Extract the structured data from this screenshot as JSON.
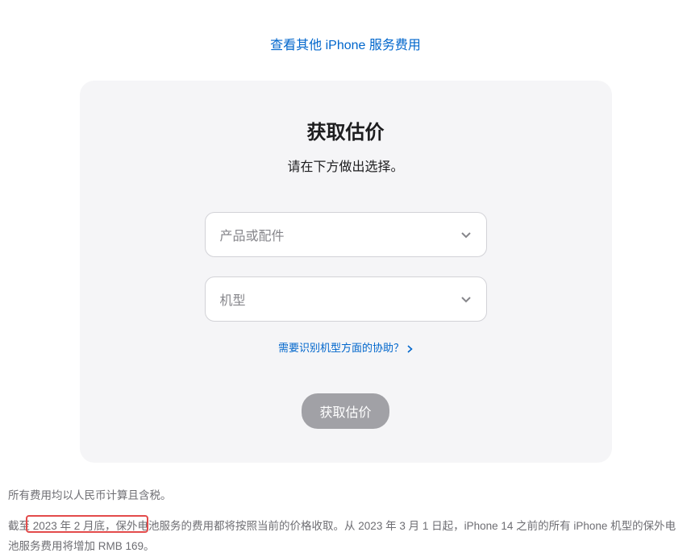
{
  "topLink": {
    "label": "查看其他 iPhone 服务费用"
  },
  "card": {
    "title": "获取估价",
    "subtitle": "请在下方做出选择。",
    "select1": {
      "placeholder": "产品或配件"
    },
    "select2": {
      "placeholder": "机型"
    },
    "helpLink": "需要识别机型方面的协助？",
    "submit": "获取估价"
  },
  "footnotes": {
    "line1": "所有费用均以人民币计算且含税。",
    "line2": "截至 2023 年 2 月底，保外电池服务的费用都将按照当前的价格收取。从 2023 年 3 月 1 日起，iPhone 14 之前的所有 iPhone 机型的保外电池服务费用将增加 RMB 169。"
  }
}
